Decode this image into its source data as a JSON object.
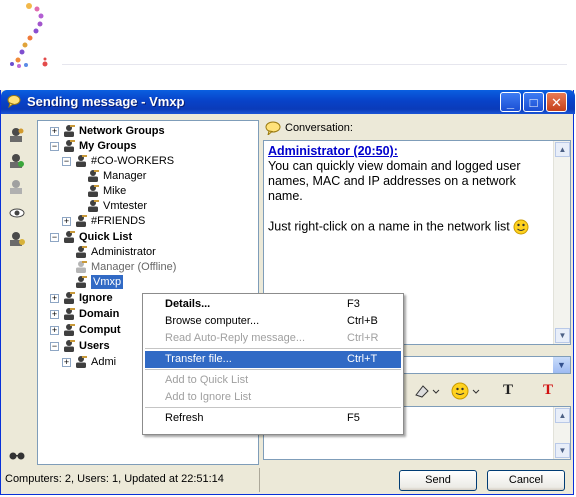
{
  "window": {
    "title": "Sending message - Vmxp",
    "minimize_glyph": "_",
    "maximize_glyph": "□",
    "close_glyph": "✕"
  },
  "tree": {
    "nodes": [
      {
        "label": "Network Groups",
        "bold": true,
        "expander": "+"
      },
      {
        "label": "My Groups",
        "bold": true,
        "expander": "−"
      },
      {
        "label": "#CO-WORKERS",
        "bold": false,
        "expander": "−"
      },
      {
        "label": "Manager",
        "bold": false
      },
      {
        "label": "Mike",
        "bold": false
      },
      {
        "label": "Vmtester",
        "bold": false
      },
      {
        "label": "#FRIENDS",
        "bold": false,
        "expander": "+"
      },
      {
        "label": "Quick List",
        "bold": true,
        "expander": "−"
      },
      {
        "label": "Administrator",
        "bold": false
      },
      {
        "label": "Manager (Offline)",
        "bold": false
      },
      {
        "label": "Vmxp",
        "bold": false
      },
      {
        "label": "Ignore",
        "bold": true,
        "expander": "+"
      },
      {
        "label": "Domain",
        "bold": true,
        "expander": "+"
      },
      {
        "label": "Comput",
        "bold": true,
        "expander": "+"
      },
      {
        "label": "Users",
        "bold": true,
        "expander": "−"
      },
      {
        "label": "Admi",
        "bold": false,
        "expander": "+"
      }
    ]
  },
  "conversation": {
    "header": "Conversation:",
    "sender": "Administrator (20:50):",
    "line1": "You can quickly view domain and logged user names, MAC and IP addresses on a network name.",
    "line2": "Just right-click on a name in the network list"
  },
  "context_menu": {
    "items": [
      {
        "label": "Details...",
        "shortcut": "F3",
        "bold": true,
        "disabled": false,
        "highlighted": false
      },
      {
        "label": "Browse computer...",
        "shortcut": "Ctrl+B",
        "bold": false,
        "disabled": false,
        "highlighted": false
      },
      {
        "label": "Read Auto-Reply message...",
        "shortcut": "Ctrl+R",
        "bold": false,
        "disabled": true,
        "highlighted": false
      },
      {
        "label": "Transfer file...",
        "shortcut": "Ctrl+T",
        "bold": false,
        "disabled": false,
        "highlighted": true
      },
      {
        "label": "Add to Quick List",
        "shortcut": "",
        "bold": false,
        "disabled": true,
        "highlighted": false
      },
      {
        "label": "Add to Ignore List",
        "shortcut": "",
        "bold": false,
        "disabled": true,
        "highlighted": false
      },
      {
        "label": "Refresh",
        "shortcut": "F5",
        "bold": false,
        "disabled": false,
        "highlighted": false
      }
    ]
  },
  "format_toolbar": {
    "font_glyph": "T",
    "font_color_glyph": "T"
  },
  "status": {
    "text": "Computers: 2, Users: 1, Updated at 22:51:14"
  },
  "buttons": {
    "send": "Send",
    "cancel": "Cancel"
  },
  "colors": {
    "titlebar": "#0a4fd2",
    "selection": "#316ac5",
    "link": "#0000cc"
  }
}
